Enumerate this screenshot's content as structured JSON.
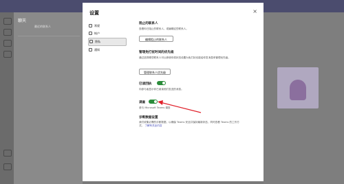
{
  "background": {
    "left_panel_title": "聊天",
    "left_panel_item": "最近的联系人"
  },
  "dialog": {
    "title": "设置",
    "close_glyph": "×",
    "nav": [
      {
        "label": "常规",
        "icon": "settings-icon"
      },
      {
        "label": "帐户",
        "icon": "account-icon"
      },
      {
        "label": "隐私",
        "icon": "privacy-icon",
        "active": true
      },
      {
        "label": "通知",
        "icon": "bell-icon"
      }
    ]
  },
  "privacy": {
    "blocked_heading": "阻止的联系人",
    "blocked_desc": "查看你已阻止的联系人，或编辑这些联系人。",
    "blocked_button": "编辑阻止的联系人",
    "priority_heading": "管理免打扰时间的优先级",
    "priority_desc": "通过选择哪些联系人可以即使你将状态设置为免打扰也能给你发消息来管理优先级。",
    "priority_button": "管理联系人优先级",
    "read_receipts_heading": "已读回执",
    "read_receipts_desc": "向参与者显示你已阅读他们发送的消息。",
    "read_receipts_on": true,
    "survey_heading": "调查",
    "survey_desc": "参与 Microsoft Teams 调查",
    "survey_on": true,
    "diag_heading": "诊断数据设置",
    "diag_desc": "我们收集必需的诊断数据，以确保 Teams 安全并保持最新状态，同时查看 Teams 的工作方式。",
    "diag_link": "了解有关此内容"
  },
  "colors": {
    "toggle_on": "#2a8c3a",
    "annotation_arrow": "#e0202a",
    "link": "#4b53bc"
  }
}
